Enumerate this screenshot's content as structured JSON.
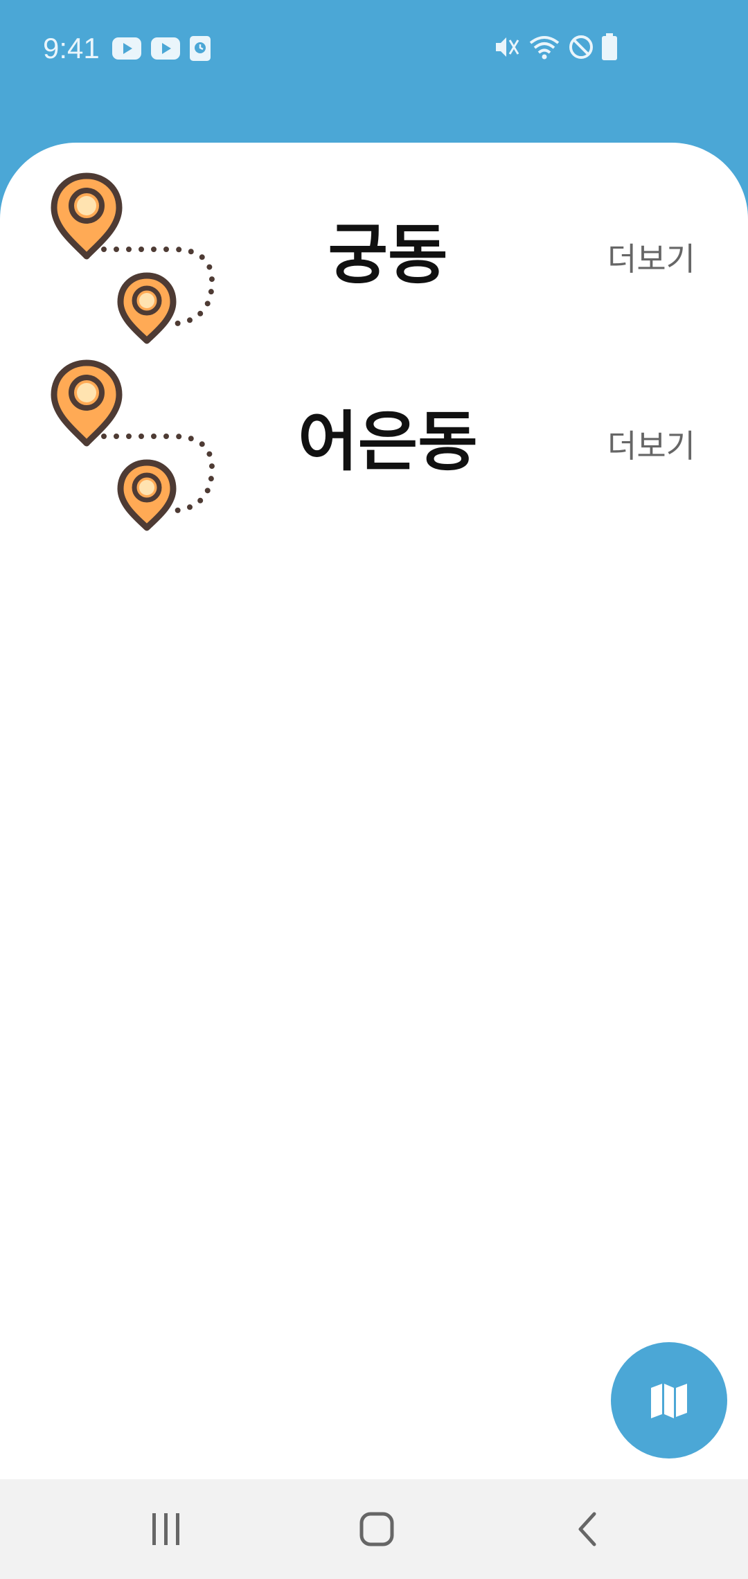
{
  "status_bar": {
    "time": "9:41",
    "left_icons": [
      "youtube-icon",
      "youtube-icon",
      "clock-app-icon"
    ],
    "right_icons": [
      "mute-icon",
      "wifi-icon",
      "do-not-disturb-icon",
      "battery-icon"
    ]
  },
  "regions": [
    {
      "name": "궁동",
      "more_label": "더보기",
      "icon": "route-pins-icon"
    },
    {
      "name": "어은동",
      "more_label": "더보기",
      "icon": "route-pins-icon"
    }
  ],
  "fab": {
    "icon": "map-icon"
  },
  "nav_bar": {
    "buttons": [
      "recents-icon",
      "home-icon",
      "back-icon"
    ]
  },
  "colors": {
    "primary": "#4BA7D6",
    "pin_fill": "#FFAA55",
    "pin_inner": "#FFE3B0",
    "pin_outline": "#4E3B34",
    "sheet": "#FFFFFF",
    "nav_bar": "#F2F2F2",
    "text_primary": "#111111",
    "text_secondary": "#666666"
  }
}
